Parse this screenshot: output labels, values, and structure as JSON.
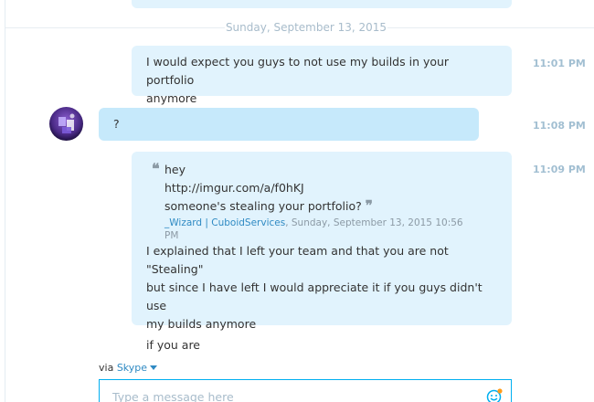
{
  "conversation": {
    "date_separator": "Sunday, September 13, 2015",
    "messages": [
      {
        "author": "self",
        "time": "11:01 PM",
        "lines": [
          "I would expect you guys to not use my builds in your portfolio",
          "anymore"
        ]
      },
      {
        "author": "other",
        "time": "11:08 PM",
        "text": "?"
      },
      {
        "author": "self",
        "time": "11:09 PM",
        "quote": {
          "lines": [
            "hey",
            "http://imgur.com/a/f0hKJ",
            "someone's stealing your portfolio?"
          ],
          "author_name": "_Wizard | CuboidServices",
          "author_time_a": ", Sunday, September 13, 2015 10:56",
          "author_time_b": "PM"
        },
        "lines": [
          "I explained that I left your team and that you are not \"Stealing\"",
          "but since I have left I would appreciate it if you guys didn't use",
          "my builds anymore"
        ],
        "extra": "if you are"
      }
    ]
  },
  "composer": {
    "via_label": "via",
    "via_service": "Skype",
    "placeholder": "Type a message here",
    "emoji_icon": "emoticon-icon"
  },
  "icons": {
    "quote_open": "❝",
    "quote_close": "❞"
  },
  "colors": {
    "self_bubble": "#e1f3fd",
    "other_bubble": "#c6e9fb",
    "accent": "#00aff0",
    "link": "#2f8ac3",
    "timestamp": "#a2bfd2"
  }
}
